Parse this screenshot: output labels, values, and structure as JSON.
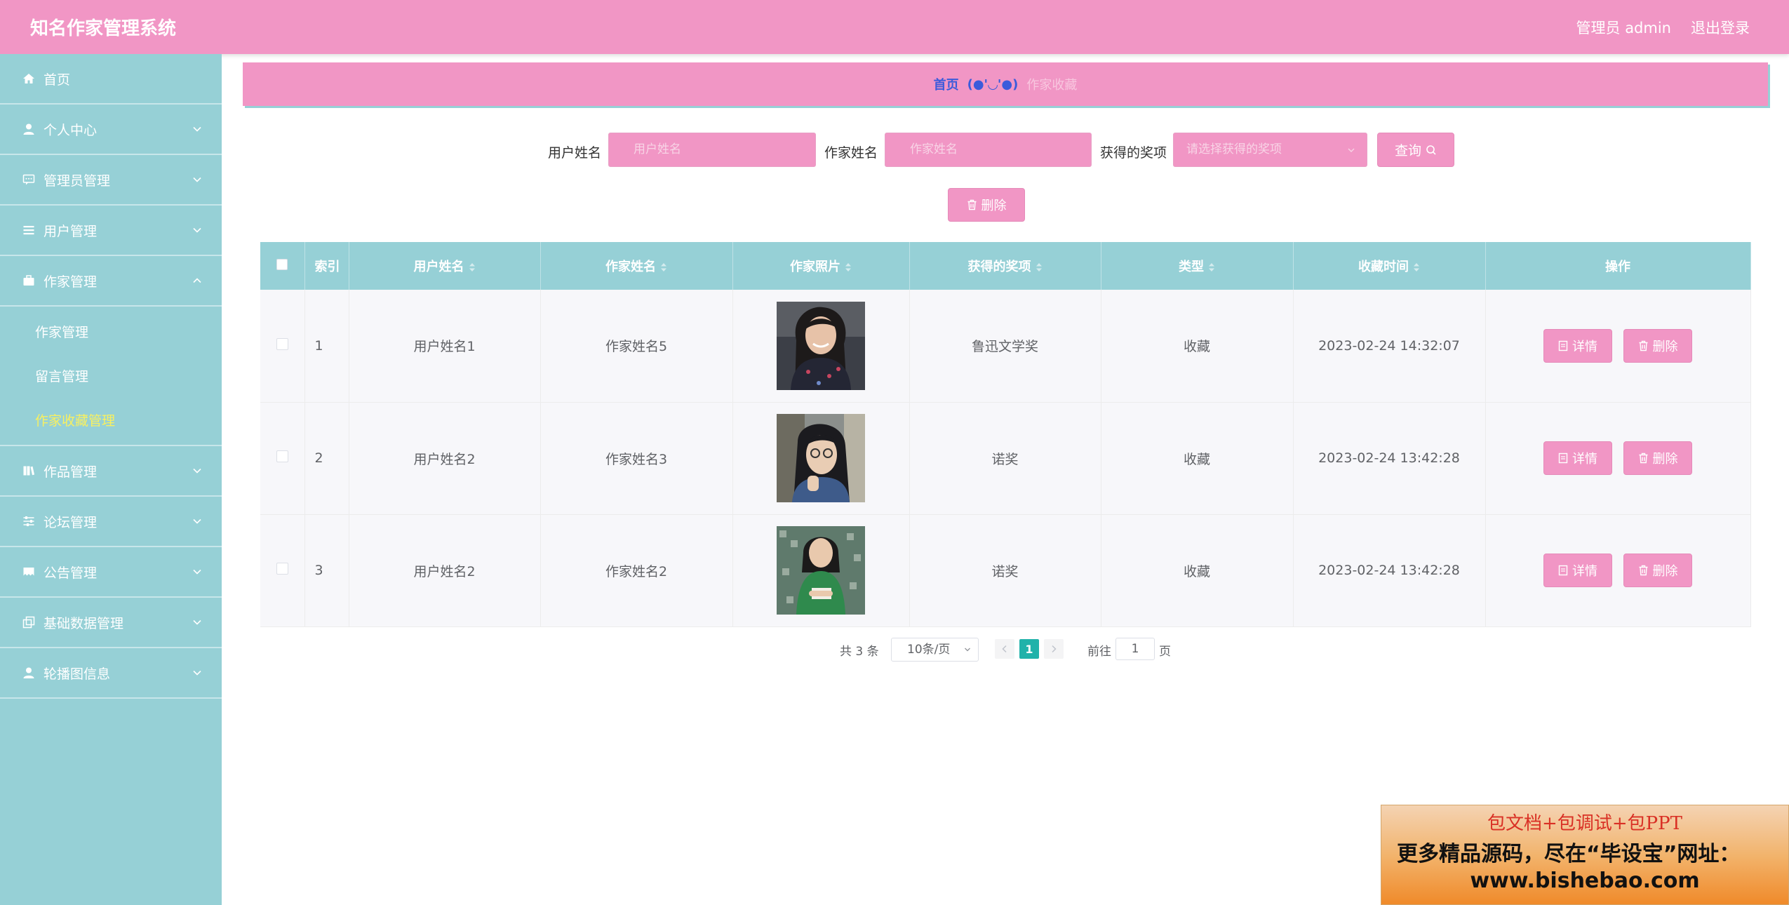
{
  "header": {
    "app_title": "知名作家管理系统",
    "admin_label": "管理员 admin",
    "logout_label": "退出登录"
  },
  "sidebar": {
    "items": [
      {
        "label": "首页",
        "icon": "home-icon"
      },
      {
        "label": "个人中心",
        "icon": "user-icon"
      },
      {
        "label": "管理员管理",
        "icon": "chat-icon"
      },
      {
        "label": "用户管理",
        "icon": "list-icon"
      },
      {
        "label": "作家管理",
        "icon": "briefcase-icon",
        "expanded": true
      },
      {
        "label": "作品管理",
        "icon": "book-icon"
      },
      {
        "label": "论坛管理",
        "icon": "sliders-icon"
      },
      {
        "label": "公告管理",
        "icon": "megaphone-icon"
      },
      {
        "label": "基础数据管理",
        "icon": "copy-icon"
      },
      {
        "label": "轮播图信息",
        "icon": "user-icon"
      }
    ],
    "subitems": [
      {
        "label": "作家管理"
      },
      {
        "label": "留言管理"
      },
      {
        "label": "作家收藏管理",
        "active": true
      }
    ]
  },
  "breadcrumb": {
    "home": "首页",
    "separator": "(●'◡'●)",
    "current": "作家收藏"
  },
  "search": {
    "user_label": "用户姓名",
    "user_placeholder": "用户姓名",
    "writer_label": "作家姓名",
    "writer_placeholder": "作家姓名",
    "award_label": "获得的奖项",
    "award_placeholder": "请选择获得的奖项",
    "query_label": "查询",
    "delete_label": "删除"
  },
  "table": {
    "headers": {
      "index": "索引",
      "user_name": "用户姓名",
      "writer_name": "作家姓名",
      "writer_photo": "作家照片",
      "award": "获得的奖项",
      "type": "类型",
      "collect_time": "收藏时间",
      "actions": "操作"
    },
    "rows": [
      {
        "index": "1",
        "user_name": "用户姓名1",
        "writer_name": "作家姓名5",
        "award": "鲁迅文学奖",
        "type": "收藏",
        "collect_time": "2023-02-24 14:32:07"
      },
      {
        "index": "2",
        "user_name": "用户姓名2",
        "writer_name": "作家姓名3",
        "award": "诺奖",
        "type": "收藏",
        "collect_time": "2023-02-24 13:42:28"
      },
      {
        "index": "3",
        "user_name": "用户姓名2",
        "writer_name": "作家姓名2",
        "award": "诺奖",
        "type": "收藏",
        "collect_time": "2023-02-24 13:42:28"
      }
    ],
    "detail_label": "详情",
    "delete_label": "删除"
  },
  "pagination": {
    "total": "共 3 条",
    "page_size": "10条/页",
    "current_page": "1",
    "goto_label": "前往",
    "goto_value": "1",
    "page_suffix": "页"
  },
  "promo": {
    "line1": "包文档+包调试+包PPT",
    "line2": "更多精品源码，尽在“毕设宝”网址：",
    "line3": "www.bishebao.com"
  },
  "colors": {
    "header_pink": "#f196c5",
    "sidebar_teal": "#96d0d6",
    "active_yellow": "#f8f060",
    "page_green": "#20b2aa"
  }
}
